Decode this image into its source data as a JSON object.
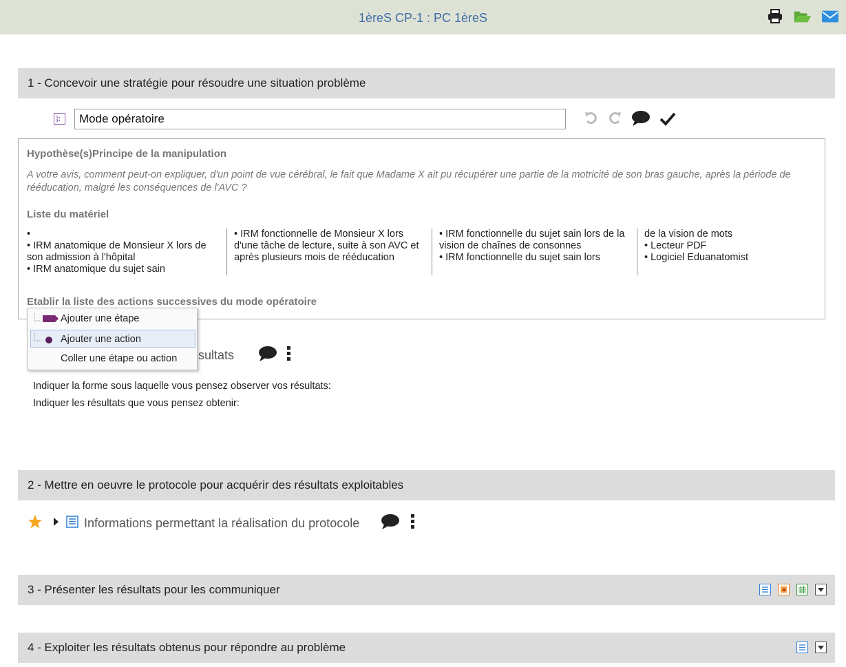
{
  "header": {
    "title": "1èreS CP-1 : PC 1èreS",
    "icons": [
      "print-icon",
      "folder-open-icon",
      "mail-icon"
    ]
  },
  "sections": [
    {
      "label": "1 - Concevoir une stratégie pour résoudre une situation problème"
    },
    {
      "label": "2 - Mettre en oeuvre le protocole pour acquérir des résultats exploitables"
    },
    {
      "label": "3 - Présenter les résultats pour les communiquer"
    },
    {
      "label": "4 - Exploiter les résultats obtenus pour répondre au problème"
    }
  ],
  "mode_operatoire": {
    "value": "Mode opératoire",
    "actions": [
      "undo-icon",
      "redo-icon",
      "comment-icon",
      "check-icon"
    ]
  },
  "panel": {
    "heading": "Hypothèse(s)Principe de la manipulation",
    "question": "A votre avis, comment peut-on expliquer, d'un point de vue cérébral, le fait que Madame X ait pu récupérer une partie de la motricité de son bras gauche, après la période de rééducation, malgré les conséquences de l'AVC ?",
    "materials_heading": "Liste du matériel",
    "materials_columns": [
      "•\n• IRM anatomique de Monsieur X lors de son admission à l'hôpital\n• IRM anatomique du sujet sain",
      "• IRM fonctionnelle de Monsieur X lors d'une tâche de lecture, suite à son AVC et après plusieurs mois de rééducation",
      "• IRM fonctionnelle du sujet sain lors de la vision de chaînes de consonnes\n• IRM fonctionnelle du sujet sain lors",
      "de la vision de mots\n• Lecteur PDF\n• Logiciel Eduanatomist"
    ],
    "actions_heading": "Etablir la liste des actions successives du mode opératoire"
  },
  "context_menu": {
    "items": [
      "Ajouter une étape",
      "Ajouter une action",
      "Coller une étape ou action"
    ]
  },
  "results": {
    "title_visible": "sultats",
    "line1": "Indiquer la forme sous laquelle vous pensez observer vos résultats:",
    "line2": "Indiquer les résultats que vous pensez obtenir:"
  },
  "info": {
    "label": "Informations permettant la réalisation du protocole"
  },
  "colors": {
    "accent_blue": "#3f6ea6",
    "header_bg": "#dee2d5",
    "section_bg": "#dcdcdc",
    "purple": "#7a2a72",
    "star": "#f5a623"
  }
}
